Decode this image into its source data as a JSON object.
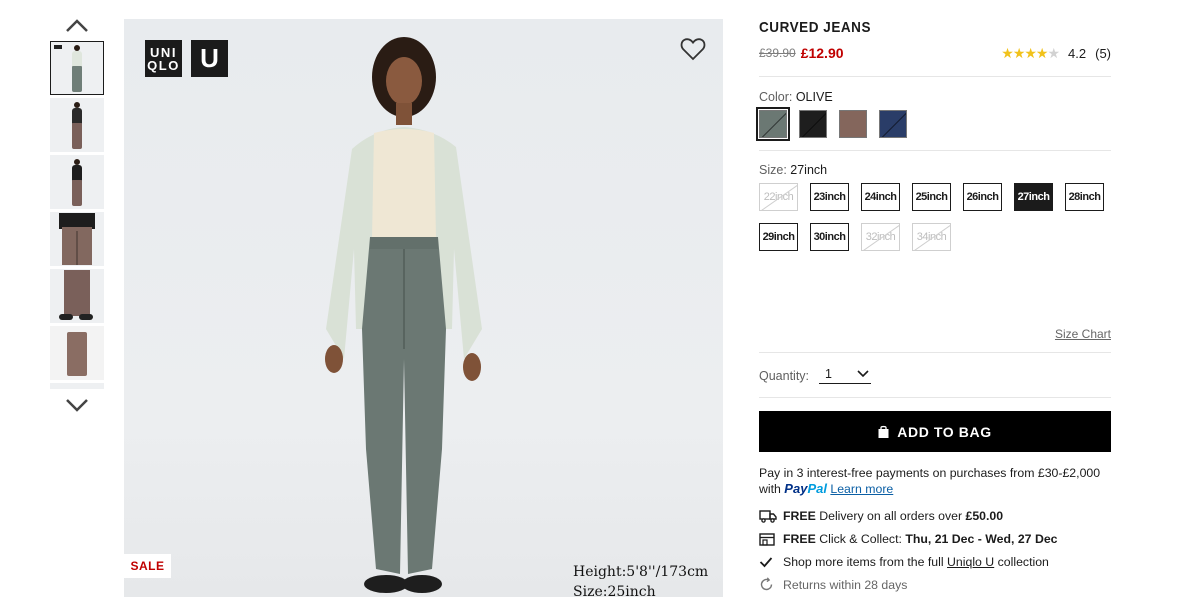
{
  "gallery": {
    "thumbnails": [
      {
        "label": "front view olive",
        "color": "#6f7e78"
      },
      {
        "label": "full length brown",
        "color": "#7a605a"
      },
      {
        "label": "back view brown",
        "color": "#7a605a"
      },
      {
        "label": "close-up brown",
        "color": "#82685f"
      },
      {
        "label": "side close-up brown",
        "color": "#7a605a"
      },
      {
        "label": "flat lay brown",
        "color": "#8a6d63"
      }
    ],
    "logo_top": "UNI",
    "logo_bottom": "QLO",
    "logo_u": "U",
    "sale_badge": "SALE",
    "caption_height": "Height:5'8''/173cm",
    "caption_size": "Size:25inch"
  },
  "product": {
    "title": "CURVED JEANS",
    "old_price": "£39.90",
    "new_price": "£12.90",
    "rating_value": 4.2,
    "rating_text": "4.2",
    "review_count": "(5)"
  },
  "color": {
    "label": "Color:",
    "selected": "OLIVE",
    "swatches": [
      {
        "name": "olive",
        "hex": "#6b7873",
        "selected": true
      },
      {
        "name": "black",
        "hex": "#1e1e1e",
        "selected": false
      },
      {
        "name": "brown",
        "hex": "#84665c",
        "selected": false
      },
      {
        "name": "navy",
        "hex": "#2a3d68",
        "selected": false
      }
    ]
  },
  "size": {
    "label": "Size:",
    "selected": "27inch",
    "options": [
      {
        "label": "22inch",
        "available": false,
        "selected": false
      },
      {
        "label": "23inch",
        "available": true,
        "selected": false
      },
      {
        "label": "24inch",
        "available": true,
        "selected": false
      },
      {
        "label": "25inch",
        "available": true,
        "selected": false
      },
      {
        "label": "26inch",
        "available": true,
        "selected": false
      },
      {
        "label": "27inch",
        "available": true,
        "selected": true
      },
      {
        "label": "28inch",
        "available": true,
        "selected": false
      },
      {
        "label": "29inch",
        "available": true,
        "selected": false
      },
      {
        "label": "30inch",
        "available": true,
        "selected": false
      },
      {
        "label": "32inch",
        "available": false,
        "selected": false
      },
      {
        "label": "34inch",
        "available": false,
        "selected": false
      }
    ],
    "chart_link": "Size Chart"
  },
  "quantity": {
    "label": "Quantity:",
    "value": "1"
  },
  "cart": {
    "add_label": "ADD TO BAG"
  },
  "payment": {
    "text": "Pay in 3 interest-free payments on purchases from £30-£2,000",
    "with": "with",
    "paypal_1": "Pay",
    "paypal_2": "Pal",
    "learn_more": "Learn more"
  },
  "delivery": {
    "line1_bold": "FREE",
    "line1_text": "Delivery on all orders over",
    "line1_amount": "£50.00",
    "line2_bold": "FREE",
    "line2_text": "Click & Collect:",
    "line2_dates": "Thu, 21 Dec - Wed, 27 Dec",
    "line3_pre": "Shop more items from the full",
    "line3_link": "Uniqlo U",
    "line3_post": "collection",
    "line4": "Returns within 28 days"
  }
}
